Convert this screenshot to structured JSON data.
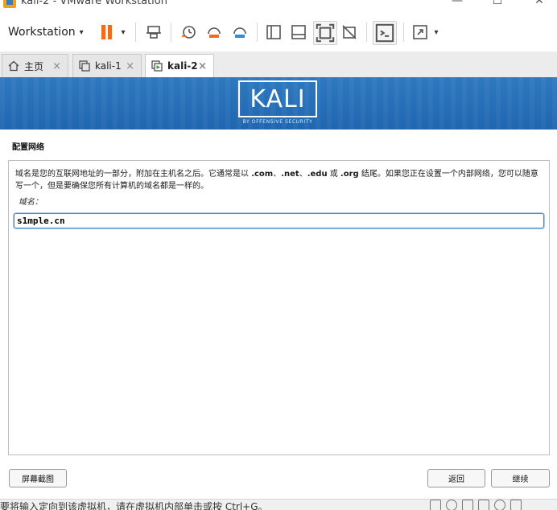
{
  "window": {
    "title": "kali-2 - VMware Workstation",
    "min_glyph": "—",
    "max_glyph": "☐",
    "close_glyph": "✕"
  },
  "toolbar": {
    "workstation_label": "Workstation",
    "caret": "▾"
  },
  "tabs": [
    {
      "label": "主页",
      "active": false,
      "close": "×"
    },
    {
      "label": "kali-1",
      "active": false,
      "close": "×"
    },
    {
      "label": "kali-2",
      "active": true,
      "close": "×"
    }
  ],
  "banner": {
    "logo_text": "KALI",
    "tagline": "BY OFFENSIVE SECURITY"
  },
  "installer": {
    "section_title": "配置网络",
    "desc_part1": "域名是您的互联网地址的一部分，附加在主机名之后。它通常是以 ",
    "desc_com": ".com",
    "desc_sep1": "、",
    "desc_net": ".net",
    "desc_sep2": "、",
    "desc_edu": ".edu",
    "desc_or": " 或 ",
    "desc_org": ".org",
    "desc_part2": " 结尾。如果您正在设置一个内部网络，您可以随意写一个，但是要确保您所有计算机的域名都是一样的。",
    "field_label": "域名：",
    "domain_value": "s1mple.cn"
  },
  "buttons": {
    "screenshot": "屏幕截图",
    "back": "返回",
    "continue": "继续"
  },
  "statusbar": {
    "text": "要将输入定向到该虚拟机，请在虚拟机内部单击或按 Ctrl+G。"
  },
  "colors": {
    "banner_blue": "#2b74bd",
    "pause_orange": "#f26a1b",
    "input_focus": "#4a86c5"
  }
}
